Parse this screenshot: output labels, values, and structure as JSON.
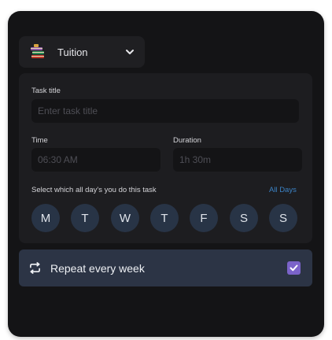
{
  "category": {
    "label": "Tuition",
    "icon": "books-icon"
  },
  "task_title": {
    "label": "Task title",
    "placeholder": "Enter task title",
    "value": ""
  },
  "time": {
    "label": "Time",
    "placeholder": "06:30 AM"
  },
  "duration": {
    "label": "Duration",
    "placeholder": "1h 30m"
  },
  "days": {
    "prompt": "Select which all day's you do this task",
    "all_days_label": "All Days",
    "items": [
      "M",
      "T",
      "W",
      "T",
      "F",
      "S",
      "S"
    ]
  },
  "repeat": {
    "label": "Repeat every week",
    "checked": true
  },
  "colors": {
    "panel_bg": "#141416",
    "card_bg": "#1d1d20",
    "day_chip": "#283446",
    "repeat_bg": "#2c3445",
    "accent_link": "#3b82c4",
    "checkbox": "#7b63c9"
  }
}
